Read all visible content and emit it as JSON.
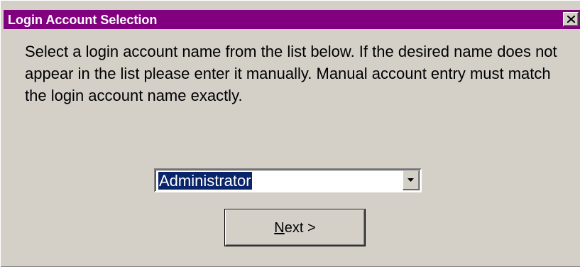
{
  "window": {
    "title": "Login Account Selection",
    "title_bar_color": "#800080",
    "close_icon": "close-icon"
  },
  "message": {
    "text": "Select a login account name from the list below. If the desired name does not appear in the list please enter it manually. Manual account entry must match the login account name exactly."
  },
  "account_select": {
    "selected_value": "Administrator",
    "highlight_color": "#0a246a",
    "dropdown_icon": "chevron-down-icon"
  },
  "next_button": {
    "mnemonic": "N",
    "label_rest": "ext",
    "arrow": ">"
  }
}
